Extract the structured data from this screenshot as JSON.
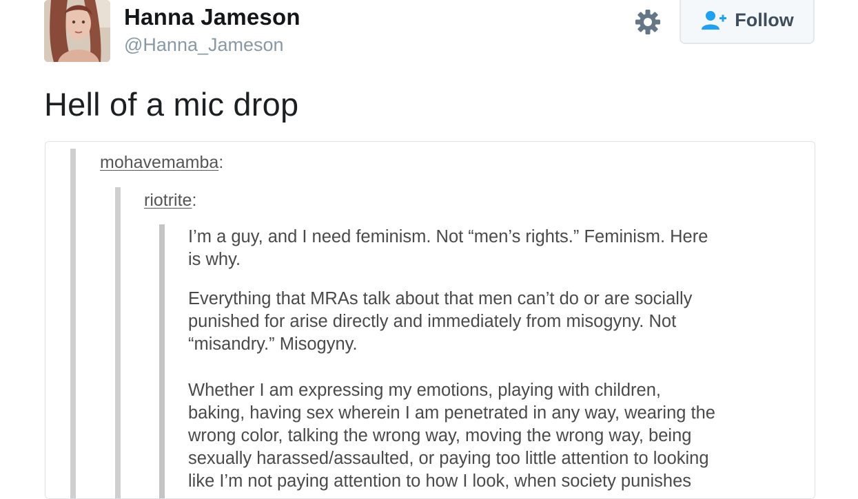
{
  "tweet": {
    "author": {
      "display_name": "Hanna Jameson",
      "handle": "@Hanna_Jameson",
      "avatar_icon": "profile-photo"
    },
    "actions": {
      "settings_icon": "gear-icon",
      "follow_icon": "add-user-icon",
      "follow_label": "Follow"
    },
    "text": "Hell of a mic drop"
  },
  "embedded_post": {
    "reblog_chain": [
      {
        "username": "mohavemamba",
        "suffix": ":"
      },
      {
        "username": "riotrite",
        "suffix": ":"
      }
    ],
    "paragraphs": [
      [
        "I’m a guy, and I need feminism. Not “men’s rights.” Feminism. Here",
        "is why."
      ],
      [
        "Everything that MRAs talk about that men can’t do or are socially",
        "punished for arise directly and immediately from misogyny. Not",
        "“misandry.” Misogyny."
      ],
      [
        "Whether I am expressing my emotions, playing with children,",
        "baking, having sex wherein I am penetrated in any way, wearing the",
        "wrong color, talking the wrong way, moving the wrong way, being",
        "sexually harassed/assaulted, or paying too little attention to looking",
        "like I’m not paying attention to how I look, when society punishes"
      ]
    ]
  },
  "colors": {
    "name_text": "#14171a",
    "handle_text": "#8899a6",
    "follow_icon_blue": "#1da1f2",
    "quote_bar": "#cfcfcf",
    "post_text": "#4a4a4a"
  }
}
